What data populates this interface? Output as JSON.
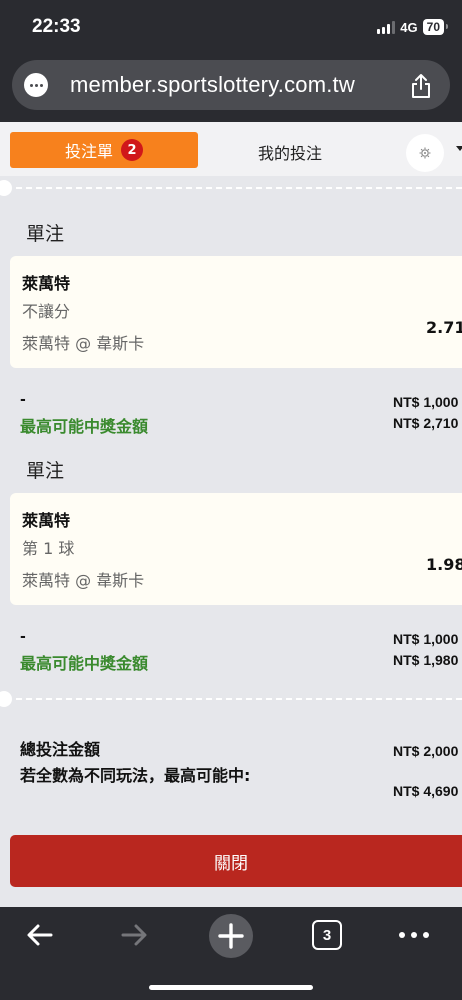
{
  "status_bar": {
    "time": "22:33",
    "network": "4G",
    "battery": "70"
  },
  "browser": {
    "url": "member.sportslottery.com.tw",
    "icons": [
      "page-menu-icon",
      "share-icon",
      "back-arrow-icon",
      "forward-arrow-icon",
      "new-tab-icon",
      "tabs-count-icon",
      "more-icon"
    ],
    "tab_count": "3"
  },
  "tabs": {
    "betslip_label": "投注單",
    "betslip_count": "2",
    "my_bets_label": "我的投注",
    "settings_icon": "gear-icon",
    "accent": "#f7811d"
  },
  "bets": [
    {
      "section_title": "單注",
      "team": "萊萬特",
      "market": "不讓分",
      "match": "萊萬特 @ 韋斯卡",
      "odds": "2.71",
      "stake_placeholder": "-",
      "stake": "NT$ 1,000",
      "max_win_label": "最高可能中獎金額",
      "max_win": "NT$ 2,710"
    },
    {
      "section_title": "單注",
      "team": "萊萬特",
      "market": "第 1 球",
      "match": "萊萬特 @ 韋斯卡",
      "odds": "1.98",
      "stake_placeholder": "-",
      "stake": "NT$ 1,000",
      "max_win_label": "最高可能中獎金額",
      "max_win": "NT$ 1,980"
    }
  ],
  "summary": {
    "total_label": "總投注金額",
    "total": "NT$ 2,000",
    "max_label": "若全數為不同玩法，最高可能中:",
    "max": "NT$ 4,690"
  },
  "close_button": "關閉",
  "colors": {
    "win_label": "#3a8a2e",
    "close_button": "#b9271f",
    "badge": "#d0171a"
  }
}
